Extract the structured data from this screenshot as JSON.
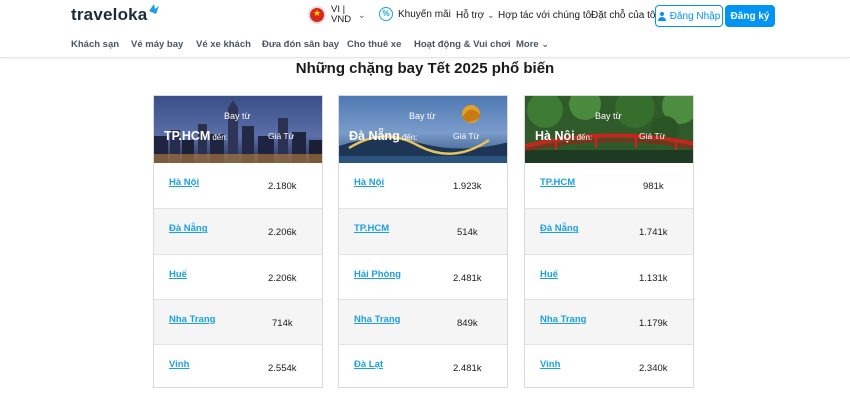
{
  "header": {
    "logo": "traveloka",
    "lang_line1": "VI |",
    "lang_line2": "VND",
    "promo": "Khuyến mãi",
    "support": "Hỗ trợ",
    "partner": "Hợp tác với chúng tôi",
    "bookings": "Đặt chỗ của tôi",
    "login": "Đăng Nhập",
    "register": "Đăng ký"
  },
  "categories": [
    "Khách sạn",
    "Vé máy bay",
    "Vé xe khách",
    "Đưa đón sân bay",
    "Cho thuê xe",
    "Hoạt động & Vui chơi",
    "More"
  ],
  "section_title": "Những chặng bay Tết 2025 phổ biến",
  "cards": [
    {
      "from_label": "Bay từ",
      "city": "TP.HCM",
      "to_label": "đến:",
      "price_label": "Giá Từ",
      "routes": [
        {
          "dest": "Hà Nội",
          "price": "2.180k"
        },
        {
          "dest": "Đà Nẵng",
          "price": "2.206k"
        },
        {
          "dest": "Huế",
          "price": "2.206k"
        },
        {
          "dest": "Nha Trang",
          "price": "714k"
        },
        {
          "dest": "Vinh",
          "price": "2.554k"
        }
      ]
    },
    {
      "from_label": "Bay từ",
      "city": "Đà Nẵng",
      "to_label": "đến:",
      "price_label": "Giá Từ",
      "routes": [
        {
          "dest": "Hà Nội",
          "price": "1.923k"
        },
        {
          "dest": "TP.HCM",
          "price": "514k"
        },
        {
          "dest": "Hải Phòng",
          "price": "2.481k"
        },
        {
          "dest": "Nha Trang",
          "price": "849k"
        },
        {
          "dest": "Đà Lạt",
          "price": "2.481k"
        }
      ]
    },
    {
      "from_label": "Bay từ",
      "city": "Hà Nội",
      "to_label": "đến:",
      "price_label": "Giá Từ",
      "routes": [
        {
          "dest": "TP.HCM",
          "price": "981k"
        },
        {
          "dest": "Đà Nẵng",
          "price": "1.741k"
        },
        {
          "dest": "Huế",
          "price": "1.131k"
        },
        {
          "dest": "Nha Trang",
          "price": "1.179k"
        },
        {
          "dest": "Vinh",
          "price": "2.340k"
        }
      ]
    }
  ]
}
